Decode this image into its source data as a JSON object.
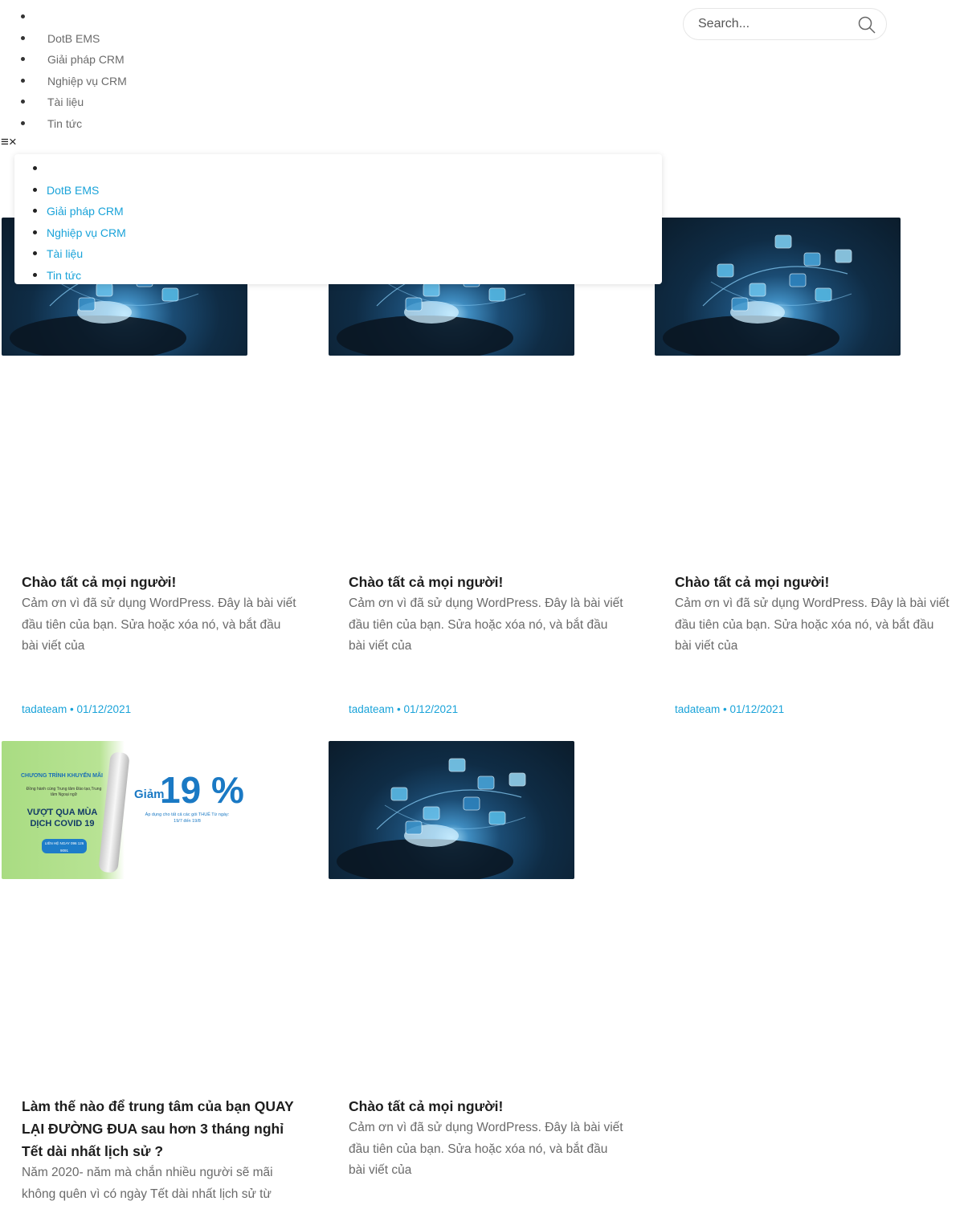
{
  "nav": {
    "items": [
      "DotB EMS",
      "Giải pháp CRM",
      "Nghiệp vụ CRM",
      "Tài liệu",
      "Tin tức"
    ]
  },
  "search": {
    "placeholder": "Search..."
  },
  "toggles": {
    "menu_icon": "≡",
    "close_icon": "×"
  },
  "dropdown": {
    "items": [
      "DotB EMS",
      "Giải pháp CRM",
      "Nghiệp vụ CRM",
      "Tài liệu",
      "Tin tức"
    ]
  },
  "cards": [
    {
      "title": "Chào tất cả mọi người!",
      "excerpt": "Cảm ơn vì đã sử dụng WordPress. Đây là bài viết đầu tiên của bạn. Sửa hoặc xóa nó, và bắt đầu bài viết của",
      "meta": "tadateam • 01/12/2021",
      "image": "tech-hand"
    },
    {
      "title": "Chào tất cả mọi người!",
      "excerpt": "Cảm ơn vì đã sử dụng WordPress. Đây là bài viết đầu tiên của bạn. Sửa hoặc xóa nó, và bắt đầu bài viết của",
      "meta": "tadateam • 01/12/2021",
      "image": "tech-hand"
    },
    {
      "title": "Chào tất cả mọi người!",
      "excerpt": "Cảm ơn vì đã sử dụng WordPress. Đây là bài viết đầu tiên của bạn. Sửa hoặc xóa nó, và bắt đầu bài viết của",
      "meta": "tadateam • 01/12/2021",
      "image": "tech-hand"
    },
    {
      "title": "Làm thế nào để trung tâm của bạn QUAY LẠI ĐƯỜNG ĐUA sau hơn 3 tháng nghỉ Tết dài nhất lịch sử ?",
      "excerpt": "Năm 2020- năm mà chắn nhiều người sẽ mãi không quên vì có ngày Tết dài nhất lịch sử từ",
      "image": "promo-banner",
      "promo": {
        "heading": "CHƯƠNG TRÌNH KHUYẾN MÃI",
        "sub": "Đồng hành cùng Trung tâm Đào tạo,Trung tâm Ngoại ngữ",
        "headline": "VƯỢT QUA MÙA DỊCH COVID 19",
        "cta": "LIÊN HỆ NGAY 096 126 9091",
        "discount_word": "Giảm",
        "discount": "19 %",
        "note": "Áp dụng cho tất cả các gói THUÊ Từ ngày: 19/7 đến 19/8"
      }
    },
    {
      "title": "Chào tất cả mọi người!",
      "excerpt": "Cảm ơn vì đã sử dụng WordPress. Đây là bài viết đầu tiên của bạn. Sửa hoặc xóa nó, và bắt đầu bài viết của",
      "image": "tech-hand"
    }
  ],
  "colors": {
    "link": "#1aa3d9",
    "title": "#1d1d1d",
    "excerpt": "#6a6a6a"
  }
}
